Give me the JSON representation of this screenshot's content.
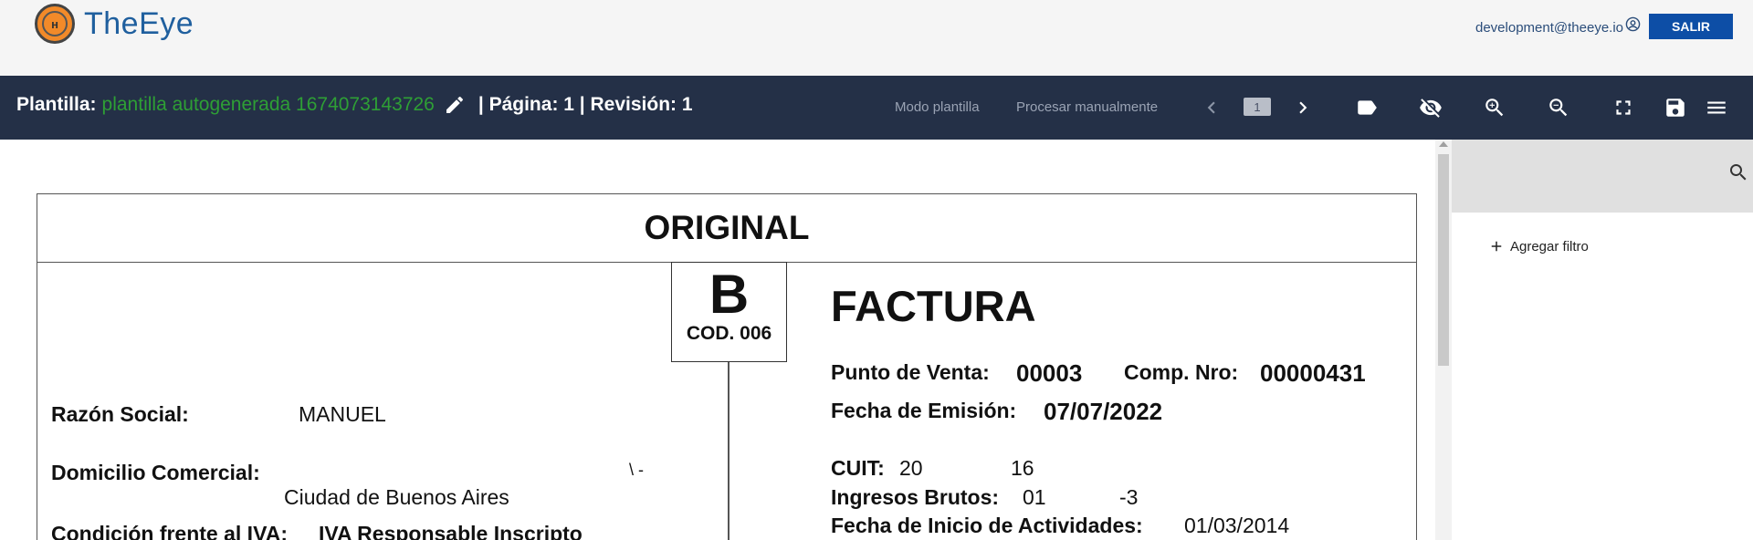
{
  "header": {
    "app_name": "TheEye",
    "user_email": "development@theeye.io",
    "logout_label": "SALIR"
  },
  "toolbar": {
    "template_label": "Plantilla:",
    "template_name": "plantilla autogenerada 1674073143726",
    "page_info": "| Página: 1 | Revisión: 1",
    "template_mode": "Modo plantilla",
    "manual_process": "Procesar manualmente",
    "page_number": "1"
  },
  "invoice": {
    "copy_label": "ORIGINAL",
    "type_letter": "B",
    "type_code": "COD. 006",
    "doc_title": "FACTURA",
    "business_name_label": "Razón Social:",
    "business_name": "MANUEL",
    "address_label": "Domicilio Comercial:",
    "address_fragment": "\\ -",
    "city": "Ciudad de Buenos Aires",
    "iva_label": "Condición frente al IVA:",
    "iva_value": "IVA Responsable Inscripto",
    "pos_label": "Punto de Venta:",
    "pos_value": "00003",
    "comp_label": "Comp. Nro:",
    "comp_value": "00000431",
    "issue_label": "Fecha de Emisión:",
    "issue_date": "07/07/2022",
    "cuit_label": "CUIT:",
    "cuit_a": "20",
    "cuit_b": "16",
    "gross_label": "Ingresos Brutos:",
    "gross_a": "01",
    "gross_b": "-3",
    "start_label": "Fecha de Inicio de Actividades:",
    "start_date": "01/03/2014"
  },
  "sidebar": {
    "add_filter_label": "Agregar filtro"
  },
  "colors": {
    "toolbar_bg": "#243047",
    "template_name": "#2e9f35",
    "logout_bg": "#0d4ea6",
    "logo_orange": "#f28a29"
  }
}
